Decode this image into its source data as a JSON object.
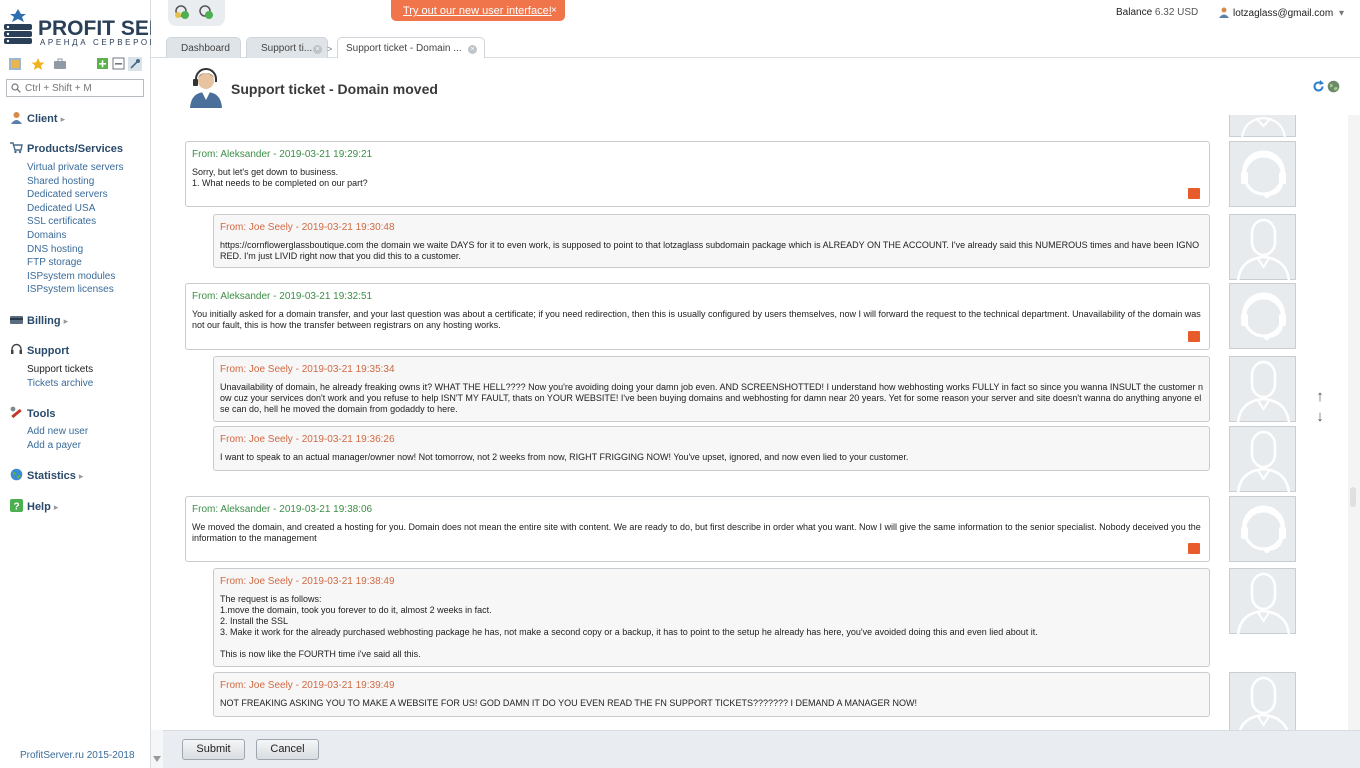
{
  "app": {
    "logo_name": "PROFIT SERVER",
    "logo_sub": "АРЕНДА СЕРВЕРОВ"
  },
  "topbar": {
    "banner_text": "Try out our new user interface!",
    "banner_close": "×",
    "balance_label": "Balance",
    "balance_value": "6.32 USD",
    "user_email": "lotzaglass@gmail.com",
    "user_caret": "▾"
  },
  "search": {
    "placeholder": "Ctrl + Shift + M"
  },
  "sidebar": {
    "client": "Client",
    "products": "Products/Services",
    "products_items": [
      "Virtual private servers",
      "Shared hosting",
      "Dedicated servers",
      "Dedicated USA",
      "SSL certificates",
      "Domains",
      "DNS hosting",
      "FTP storage",
      "ISPsystem modules",
      "ISPsystem licenses"
    ],
    "billing": "Billing",
    "support": "Support",
    "support_items": [
      "Support tickets",
      "Tickets archive"
    ],
    "tools": "Tools",
    "tools_items": [
      "Add new user",
      "Add a payer"
    ],
    "statistics": "Statistics",
    "help": "Help",
    "arrow": "▸",
    "copyright": "ProfitServer.ru 2015-2018"
  },
  "tabs": [
    {
      "label": "Dashboard"
    },
    {
      "label": "Support ti..."
    },
    {
      "label": "Support ticket - Domain ..."
    }
  ],
  "crumb_arrow": ">",
  "page": {
    "title": "Support ticket - Domain moved"
  },
  "messages": [
    {
      "from": "From: Aleksander - 2019-03-21 19:29:21",
      "body": "Sorry, but let's get down to business.\n1. What needs to be completed on our part?"
    },
    {
      "from": "From: Joe Seely - 2019-03-21 19:30:48",
      "body": "https://cornflowerglassboutique.com the domain we waite DAYS for it to even work, is supposed to point to that lotzaglass subdomain package which is ALREADY ON THE ACCOUNT. I've already said this NUMEROUS times and have been IGNORED. I'm just LIVID right now that you did this to a customer."
    },
    {
      "from": "From: Aleksander - 2019-03-21 19:32:51",
      "body": "You initially asked for a domain transfer, and your last question was about a certificate; if you need redirection, then this is usually configured by users themselves, now I will forward the request to the technical department. Unavailability of the domain was not our fault, this is how the transfer between registrars on any hosting works."
    },
    {
      "from": "From: Joe Seely - 2019-03-21 19:35:34",
      "body": "Unavailability of domain, he already freaking owns it? WHAT THE HELL???? Now you're avoiding doing your damn job even. AND SCREENSHOTTED! I understand how webhosting works FULLY in fact so since you wanna INSULT the customer now cuz your services don't work and you refuse to help ISN'T MY FAULT, thats on YOUR WEBSITE! I've been buying domains and webhosting for damn near 20 years. Yet for some reason your server and site doesn't wanna do anything anyone else can do, hell he moved the domain from godaddy to here."
    },
    {
      "from": "From: Joe Seely - 2019-03-21 19:36:26",
      "body": "I want to speak to an actual manager/owner now! Not tomorrow, not 2 weeks from now, RIGHT FRIGGING NOW! You've upset, ignored, and now even lied to your customer."
    },
    {
      "from": "From: Aleksander - 2019-03-21 19:38:06",
      "body": "We moved the domain, and created a hosting for you. Domain does not mean the entire site with content. We are ready to do, but first describe in order what you want. Now I will give the same information to the senior specialist. Nobody deceived you the information to the management"
    },
    {
      "from": "From: Joe Seely - 2019-03-21 19:38:49",
      "body": "The request is as follows:\n1.move the domain, took you forever to do it, almost 2 weeks in fact.\n2. Install the SSL\n3. Make it work for the already purchased webhosting package he has, not make a second copy or a backup, it has to point to the setup he already has here, you've avoided doing this and even lied about it.\n\nThis is now like the FOURTH time i've said all this."
    },
    {
      "from": "From: Joe Seely - 2019-03-21 19:39:49",
      "body": "NOT FREAKING ASKING YOU TO MAKE A WEBSITE FOR US! GOD DAMN IT DO YOU EVEN READ THE FN SUPPORT TICKETS??????? I DEMAND A MANAGER NOW!"
    }
  ],
  "scroll_arrows": {
    "up": "↑",
    "down": "↓"
  },
  "footer": {
    "submit": "Submit",
    "cancel": "Cancel"
  },
  "colors": {
    "staff_from": "#3b8e46",
    "client_from": "#d06a43",
    "banner": "#f0754a",
    "link": "#3a6b9a"
  },
  "icons": [
    "logo-servers-icon",
    "favorites-star-icon",
    "briefcase-icon",
    "expand-all-icon",
    "collapse-all-icon",
    "pin-icon",
    "search-icon",
    "client-icon",
    "cart-icon",
    "billing-icon",
    "headset-icon",
    "tools-icon",
    "statistics-globe-icon",
    "help-icon",
    "refresh-icon",
    "globe-icon",
    "user-icon",
    "staff-headset-avatar",
    "client-person-avatar",
    "reply-icon"
  ]
}
